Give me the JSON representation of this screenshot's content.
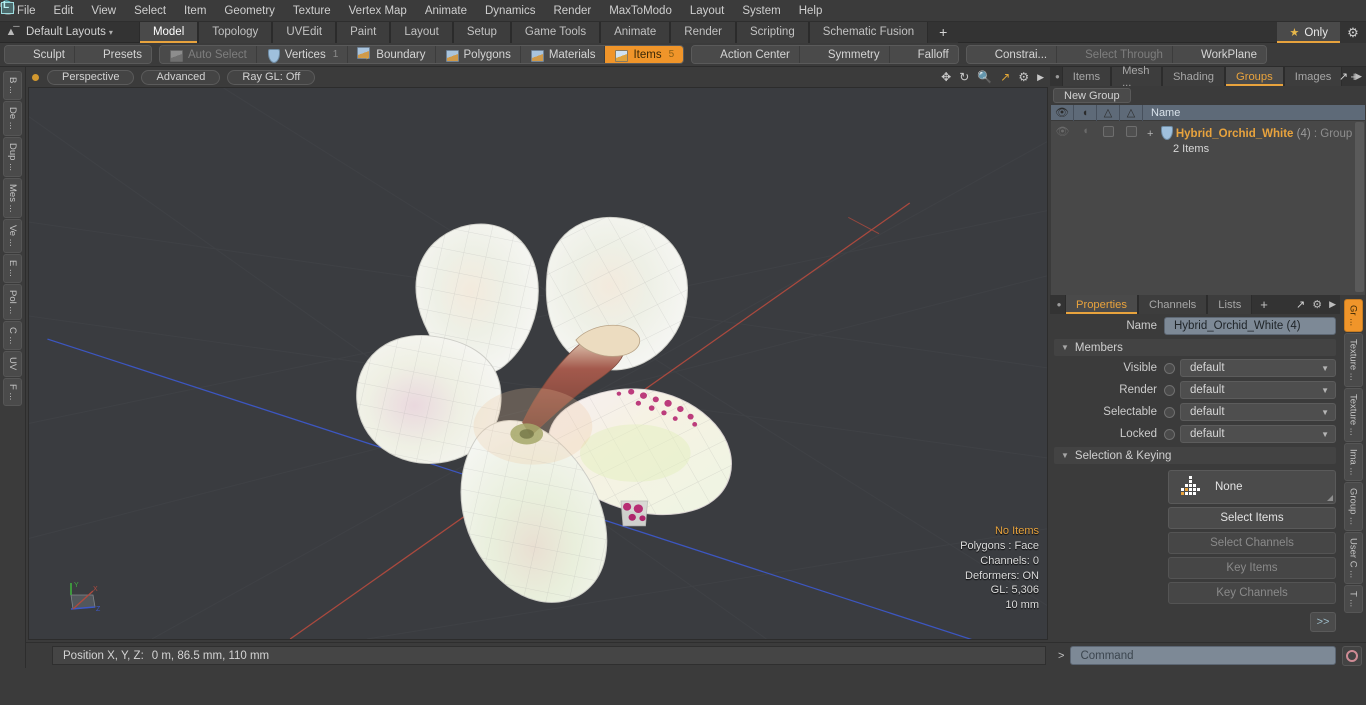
{
  "menu": {
    "items": [
      "File",
      "Edit",
      "View",
      "Select",
      "Item",
      "Geometry",
      "Texture",
      "Vertex Map",
      "Animate",
      "Dynamics",
      "Render",
      "MaxToModo",
      "Layout",
      "System",
      "Help"
    ]
  },
  "layout_bar": {
    "home_icon": "home-icon",
    "layout_name": "Default Layouts",
    "caret": "▾",
    "tabs": [
      {
        "label": "Model",
        "active": true
      },
      {
        "label": "Topology",
        "active": false
      },
      {
        "label": "UVEdit",
        "active": false
      },
      {
        "label": "Paint",
        "active": false
      },
      {
        "label": "Layout",
        "active": false
      },
      {
        "label": "Setup",
        "active": false
      },
      {
        "label": "Game Tools",
        "active": false
      },
      {
        "label": "Animate",
        "active": false
      },
      {
        "label": "Render",
        "active": false
      },
      {
        "label": "Scripting",
        "active": false
      },
      {
        "label": "Schematic Fusion",
        "active": false
      }
    ],
    "add_tab": "+",
    "only_label": "Only",
    "star": "★",
    "gear": "⚙"
  },
  "mode_toolbar": {
    "group1": [
      {
        "label": "Sculpt",
        "icon": "sculpt-icon",
        "state": "normal"
      },
      {
        "label": "Presets",
        "icon": "presets-icon",
        "state": "normal"
      }
    ],
    "group2": [
      {
        "label": "Auto Select",
        "icon": "cube-grey-icon",
        "state": "dim",
        "num": ""
      },
      {
        "label": "Vertices",
        "icon": "shield-icon",
        "state": "normal",
        "num": "1"
      },
      {
        "label": "Boundary",
        "icon": "arrow-cube-icon",
        "state": "normal",
        "num": ""
      },
      {
        "label": "Polygons",
        "icon": "cube-blue-icon",
        "state": "normal",
        "num": ""
      },
      {
        "label": "Materials",
        "icon": "cube-blue-icon",
        "state": "normal",
        "num": ""
      },
      {
        "label": "Items",
        "icon": "cube-orange-icon",
        "state": "selected",
        "num": "5"
      }
    ],
    "group3": [
      {
        "label": "Action Center",
        "icon": "target-icon",
        "state": "normal"
      },
      {
        "label": "Symmetry",
        "icon": "symmetry-icon",
        "state": "normal"
      },
      {
        "label": "Falloff",
        "icon": "falloff-icon",
        "state": "normal"
      }
    ],
    "group4": [
      {
        "label": "Constrai...",
        "icon": "constraint-icon",
        "state": "normal"
      },
      {
        "label": "Select Through",
        "icon": "select-through-icon",
        "state": "dim"
      },
      {
        "label": "WorkPlane",
        "icon": "workplane-icon",
        "state": "normal"
      }
    ]
  },
  "left_strip": {
    "tabs": [
      "B ...",
      "De ...",
      "Dup ...",
      "Mes ...",
      "Ve ...",
      "E ...",
      "Pol ...",
      "C ...",
      "UV",
      "F ..."
    ]
  },
  "viewport": {
    "header": {
      "dot": "viewport-active-dot",
      "pills": [
        "Perspective",
        "Advanced",
        "Ray GL: Off"
      ],
      "icons": [
        "move-icon",
        "rotate-icon",
        "zoom-icon",
        "fit-icon",
        "gear-icon",
        "play-icon"
      ]
    },
    "stats": {
      "selection": "No Items",
      "polygons": "Polygons : Face",
      "channels": "Channels: 0",
      "deformers": "Deformers: ON",
      "gl": "GL: 5,306",
      "scale": "10 mm"
    },
    "axis_gizmo": {
      "x": "X",
      "y": "Y",
      "z": "Z"
    },
    "scene": "white hybrid orchid flower mesh with wireframe overlay"
  },
  "status_bar": {
    "position_label": "Position X, Y, Z:",
    "position_value": "0 m, 86.5 mm, 110 mm"
  },
  "right_panel": {
    "top_tabs": [
      {
        "label": "Items",
        "active": false
      },
      {
        "label": "Mesh ...",
        "active": false
      },
      {
        "label": "Shading",
        "active": false
      },
      {
        "label": "Groups",
        "active": true
      },
      {
        "label": "Images",
        "active": false
      }
    ],
    "top_tabs_add": "+",
    "new_group_button": "New Group",
    "tree": {
      "columns": [
        "eye-icon",
        "shade-icon",
        "wire-icon",
        "ghost-icon"
      ],
      "name_header": "Name",
      "rows": [
        {
          "expander": "+",
          "icon": "group-shield-icon",
          "name": "Hybrid_Orchid_White",
          "count": "(4)",
          "type": ": Group",
          "sub": "2 Items"
        }
      ]
    },
    "prop_tabs": [
      {
        "label": "Properties",
        "active": true
      },
      {
        "label": "Channels",
        "active": false
      },
      {
        "label": "Lists",
        "active": false
      }
    ],
    "prop_tabs_add": "+",
    "name_label": "Name",
    "name_value": "Hybrid_Orchid_White (4)",
    "members_section": "Members",
    "members": [
      {
        "label": "Visible",
        "value": "default"
      },
      {
        "label": "Render",
        "value": "default"
      },
      {
        "label": "Selectable",
        "value": "default"
      },
      {
        "label": "Locked",
        "value": "default"
      }
    ],
    "selection_section": "Selection & Keying",
    "selection_preset": "None",
    "selection_buttons": [
      {
        "label": "Select Items",
        "enabled": true
      },
      {
        "label": "Select Channels",
        "enabled": false
      },
      {
        "label": "Key Items",
        "enabled": false
      },
      {
        "label": "Key Channels",
        "enabled": false
      }
    ],
    "expand_button": ">>",
    "right_strip": [
      {
        "label": "Gr ...",
        "active": true
      },
      {
        "label": "Texture ...",
        "active": false
      },
      {
        "label": "Texture ...",
        "active": false
      },
      {
        "label": "Ima ...",
        "active": false
      },
      {
        "label": "Group ...",
        "active": false
      },
      {
        "label": "User C ...",
        "active": false
      },
      {
        "label": "T ...",
        "active": false
      }
    ]
  },
  "command_bar": {
    "prompt": ">",
    "placeholder": "Command",
    "record_button": "record-icon"
  },
  "colors": {
    "accent": "#e8a33d",
    "selected": "#f0952a",
    "panel": "#3b3b3b",
    "field": "#7d8996",
    "viewport_bg": "#3a3c40"
  }
}
